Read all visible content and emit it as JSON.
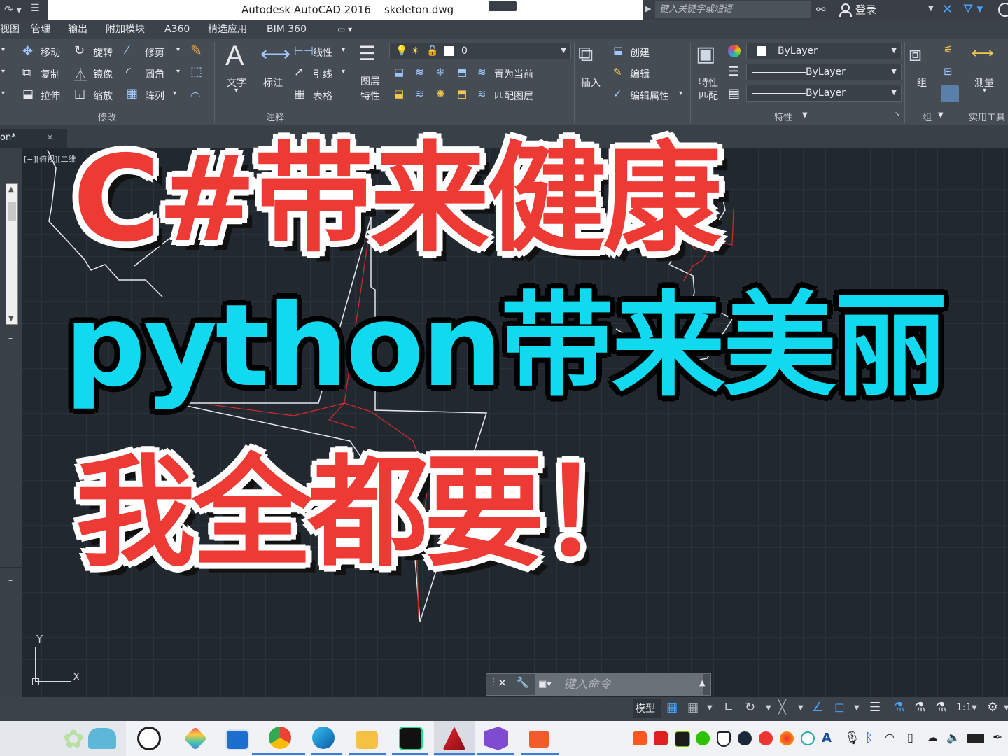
{
  "titlebar": {
    "title": "Autodesk AutoCAD 2016    skeleton.dwg",
    "search_placeholder": "键入关键字或短语",
    "login_label": "登录"
  },
  "menubar": {
    "items": [
      "视图",
      "管理",
      "输出",
      "附加模块",
      "A360",
      "精选应用",
      "BIM 360"
    ]
  },
  "ribbon": {
    "modify": {
      "move": "移动",
      "rotate": "旋转",
      "trim": "修剪",
      "copy": "复制",
      "mirror": "镜像",
      "fillet": "圆角",
      "stretch": "拉伸",
      "scale": "缩放",
      "array": "阵列",
      "panel_title": "修改"
    },
    "annotation": {
      "text": "文字",
      "dimension": "标注",
      "linear": "线性",
      "leader": "引线",
      "table": "表格",
      "panel_title": "注释"
    },
    "layers": {
      "layer_props_l1": "图层",
      "layer_props_l2": "特性",
      "current_layer": "0",
      "make_current": "置为当前",
      "match_layer": "匹配图层"
    },
    "block": {
      "insert": "插入",
      "create": "创建",
      "edit": "编辑",
      "edit_attributes": "编辑属性"
    },
    "properties": {
      "match_l1": "特性",
      "match_l2": "匹配",
      "color": "ByLayer",
      "linetype": "ByLayer",
      "lineweight": "ByLayer",
      "panel_title": "特性"
    },
    "groups": {
      "group": "组",
      "panel_title": "组"
    },
    "utilities": {
      "measure": "测量",
      "panel_title": "实用工具"
    }
  },
  "document_tab": {
    "label": "on*"
  },
  "viewport": {
    "label": "[−][俯视][二维"
  },
  "ucs": {
    "x_label": "X",
    "y_label": "Y"
  },
  "command_line": {
    "placeholder": "键入命令"
  },
  "statusbar": {
    "model_tab": "模型",
    "scale": "1:1"
  },
  "overlay": {
    "line1": "C#带来健康",
    "line2": "python带来美丽",
    "line3": "我全都要！"
  },
  "colors": {
    "overlay_red": "#ee3a34",
    "overlay_cyan": "#10d9f0",
    "canvas_bg": "#212830",
    "ribbon_bg": "#464c54"
  },
  "taskbar": {
    "apps": [
      "dell-icon",
      "app-launcher-icon",
      "file-explorer-window-icon",
      "chrome-icon",
      "edge-icon",
      "file-explorer-icon",
      "pycharm-icon",
      "autocad-icon",
      "visual-studio-icon",
      "powerpoint-icon"
    ]
  }
}
